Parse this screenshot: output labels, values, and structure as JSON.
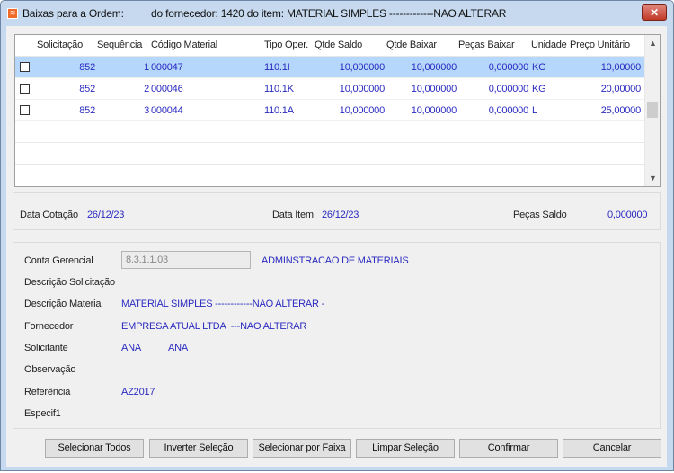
{
  "window": {
    "title": "Baixas para a Ordem:",
    "subtitle": "do fornecedor: 1420   do item: MATERIAL SIMPLES -------------NAO ALTERAR",
    "close": "✕"
  },
  "grid": {
    "columns": [
      "Solicitação",
      "Sequência",
      "Código Material",
      "Tipo Oper.",
      "Qtde Saldo",
      "Qtde Baixar",
      "Peças Baixar",
      "Unidade",
      "Preço Unitário"
    ],
    "rows": [
      {
        "solicitacao": "852",
        "sequencia": "1",
        "codigo": "000047",
        "tipo": "110.1I",
        "saldo": "10,000000",
        "baixar": "10,000000",
        "pecas": "0,000000",
        "unidade": "KG",
        "preco": "10,00000",
        "checked": false,
        "selected": true
      },
      {
        "solicitacao": "852",
        "sequencia": "2",
        "codigo": "000046",
        "tipo": "110.1K",
        "saldo": "10,000000",
        "baixar": "10,000000",
        "pecas": "0,000000",
        "unidade": "KG",
        "preco": "20,00000",
        "checked": false,
        "selected": false
      },
      {
        "solicitacao": "852",
        "sequencia": "3",
        "codigo": "000044",
        "tipo": "110.1A",
        "saldo": "10,000000",
        "baixar": "10,000000",
        "pecas": "0,000000",
        "unidade": "L",
        "preco": "25,00000",
        "checked": false,
        "selected": false
      }
    ]
  },
  "summary": {
    "data_cotacao_label": "Data Cotação",
    "data_cotacao": "26/12/23",
    "data_item_label": "Data Item",
    "data_item": "26/12/23",
    "pecas_saldo_label": "Peças Saldo",
    "pecas_saldo": "0,000000"
  },
  "details": {
    "conta_label": "Conta Gerencial",
    "conta_value": "8.3.1.1.03",
    "conta_desc": "ADMINSTRACAO DE MATERIAIS",
    "desc_sol_label": "Descrição Solicitação",
    "desc_mat_label": "Descrição Material",
    "desc_mat": "MATERIAL SIMPLES ------------NAO ALTERAR -",
    "fornecedor_label": "Fornecedor",
    "fornecedor": "EMPRESA ATUAL LTDA  ---NAO ALTERAR",
    "solicitante_label": "Solicitante",
    "solicitante1": "ANA",
    "solicitante2": "ANA",
    "observacao_label": "Observação",
    "referencia_label": "Referência",
    "referencia": "AZ2017",
    "especif_label": "Especif1"
  },
  "buttons": {
    "select_all": "Selecionar Todos",
    "invert": "Inverter Seleção",
    "range": "Selecionar por Faixa",
    "clear": "Limpar Seleção",
    "confirm": "Confirmar",
    "cancel": "Cancelar"
  },
  "colors": {
    "value_text": "#2a2ac0",
    "selected_row": "#b4d7fb"
  }
}
